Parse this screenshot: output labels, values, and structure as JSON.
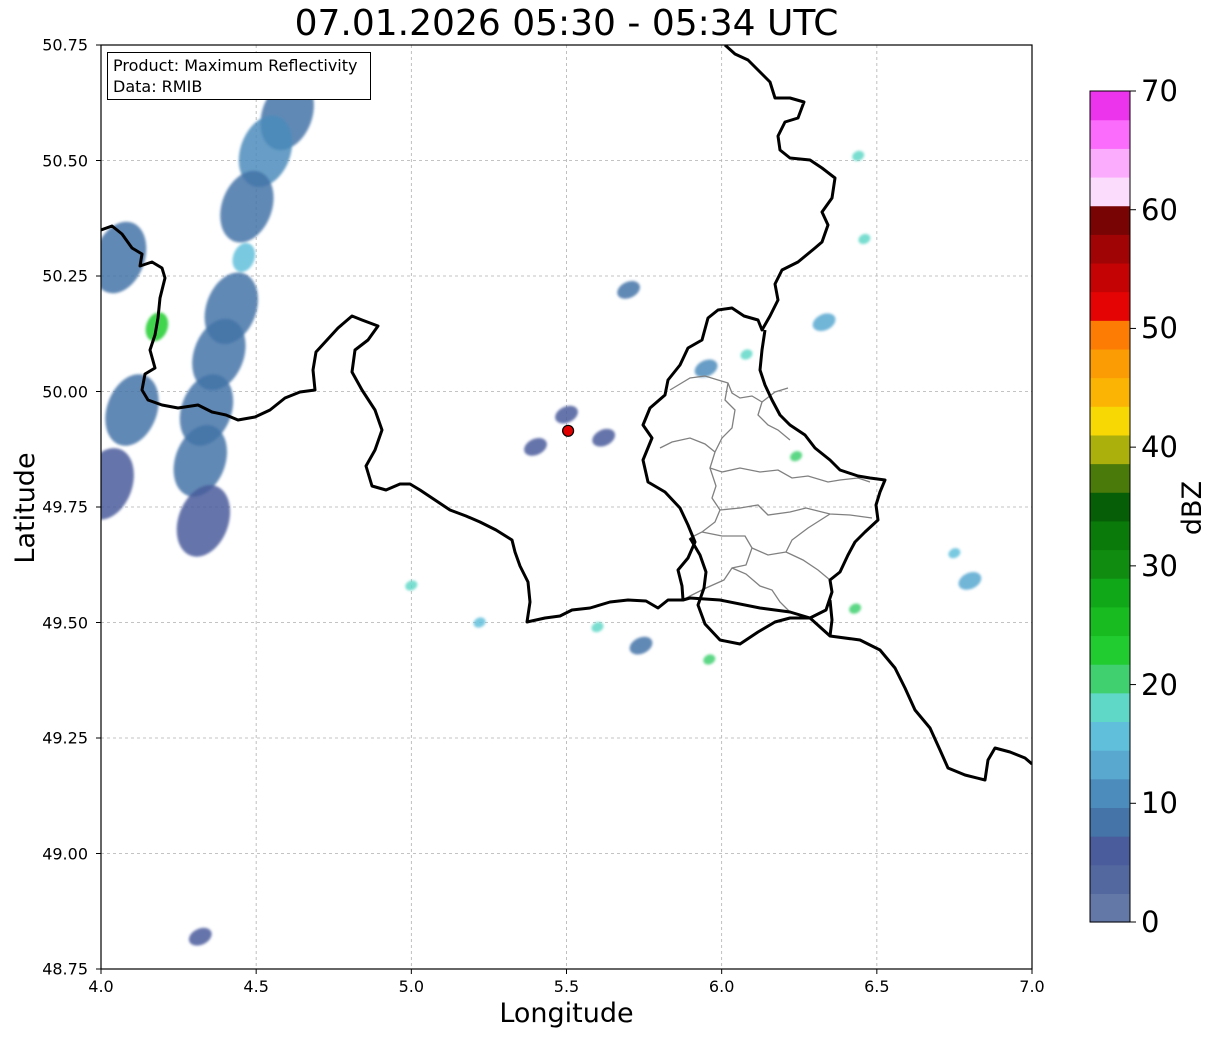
{
  "title": "07.01.2026 05:30 - 05:34 UTC",
  "info": {
    "product": "Product: Maximum Reflectivity",
    "data": "Data: RMIB"
  },
  "x_axis": {
    "label": "Longitude",
    "range": [
      4.0,
      7.0
    ],
    "ticks": [
      "4.0",
      "4.5",
      "5.0",
      "5.5",
      "6.0",
      "6.5",
      "7.0"
    ]
  },
  "y_axis": {
    "label": "Latitude",
    "range": [
      48.75,
      50.75
    ],
    "ticks": [
      "50.75",
      "50.50",
      "50.25",
      "50.00",
      "49.75",
      "49.50",
      "49.25",
      "49.00",
      "48.75"
    ]
  },
  "grid": true,
  "radar_site": {
    "lon": 5.505,
    "lat": 49.915,
    "color": "#e00000"
  },
  "colorbar": {
    "label": "dBZ",
    "range": [
      0,
      70
    ],
    "ticks": [
      "0",
      "10",
      "20",
      "30",
      "40",
      "50",
      "60",
      "70"
    ],
    "colors": [
      "#6478a8",
      "#5468a0",
      "#4a5c9c",
      "#4474a8",
      "#4c8cbc",
      "#58a8d0",
      "#60c0dc",
      "#60d8c8",
      "#40d070",
      "#20cc30",
      "#18bc20",
      "#10a818",
      "#108c10",
      "#0a7a0a",
      "#065e06",
      "#4a7a0a",
      "#acb00c",
      "#f8d804",
      "#fcb404",
      "#fc9c04",
      "#fc7c04",
      "#e40404",
      "#c40404",
      "#a00404",
      "#780404",
      "#fcdcfc",
      "#fcacfc",
      "#fc6cfc",
      "#ec34ec"
    ]
  },
  "echoes": [
    {
      "lon": 4.6,
      "lat": 50.6,
      "dbz": 8
    },
    {
      "lon": 4.53,
      "lat": 50.52,
      "dbz": 10
    },
    {
      "lon": 4.47,
      "lat": 50.4,
      "dbz": 9
    },
    {
      "lon": 4.46,
      "lat": 50.29,
      "dbz": 16
    },
    {
      "lon": 4.42,
      "lat": 50.18,
      "dbz": 9
    },
    {
      "lon": 4.38,
      "lat": 50.08,
      "dbz": 8
    },
    {
      "lon": 4.34,
      "lat": 49.96,
      "dbz": 9
    },
    {
      "lon": 4.32,
      "lat": 49.85,
      "dbz": 8
    },
    {
      "lon": 4.33,
      "lat": 49.72,
      "dbz": 7
    },
    {
      "lon": 4.18,
      "lat": 50.14,
      "dbz": 22
    },
    {
      "lon": 4.1,
      "lat": 49.96,
      "dbz": 9
    },
    {
      "lon": 4.06,
      "lat": 50.29,
      "dbz": 8
    },
    {
      "lon": 4.02,
      "lat": 49.8,
      "dbz": 6
    },
    {
      "lon": 5.7,
      "lat": 50.22,
      "dbz": 9
    },
    {
      "lon": 5.5,
      "lat": 49.95,
      "dbz": 6
    },
    {
      "lon": 5.62,
      "lat": 49.9,
      "dbz": 6
    },
    {
      "lon": 5.4,
      "lat": 49.88,
      "dbz": 6
    },
    {
      "lon": 5.95,
      "lat": 50.05,
      "dbz": 12
    },
    {
      "lon": 6.08,
      "lat": 50.08,
      "dbz": 18
    },
    {
      "lon": 6.24,
      "lat": 49.86,
      "dbz": 20
    },
    {
      "lon": 6.33,
      "lat": 50.15,
      "dbz": 14
    },
    {
      "lon": 6.46,
      "lat": 50.33,
      "dbz": 18
    },
    {
      "lon": 6.44,
      "lat": 50.51,
      "dbz": 17
    },
    {
      "lon": 5.96,
      "lat": 49.42,
      "dbz": 20
    },
    {
      "lon": 5.22,
      "lat": 49.5,
      "dbz": 16
    },
    {
      "lon": 5.0,
      "lat": 49.58,
      "dbz": 19
    },
    {
      "lon": 6.43,
      "lat": 49.53,
      "dbz": 21
    },
    {
      "lon": 6.8,
      "lat": 49.59,
      "dbz": 14
    },
    {
      "lon": 6.75,
      "lat": 49.65,
      "dbz": 15
    },
    {
      "lon": 5.6,
      "lat": 49.49,
      "dbz": 18
    },
    {
      "lon": 5.74,
      "lat": 49.45,
      "dbz": 8
    },
    {
      "lon": 4.32,
      "lat": 48.82,
      "dbz": 6
    }
  ]
}
